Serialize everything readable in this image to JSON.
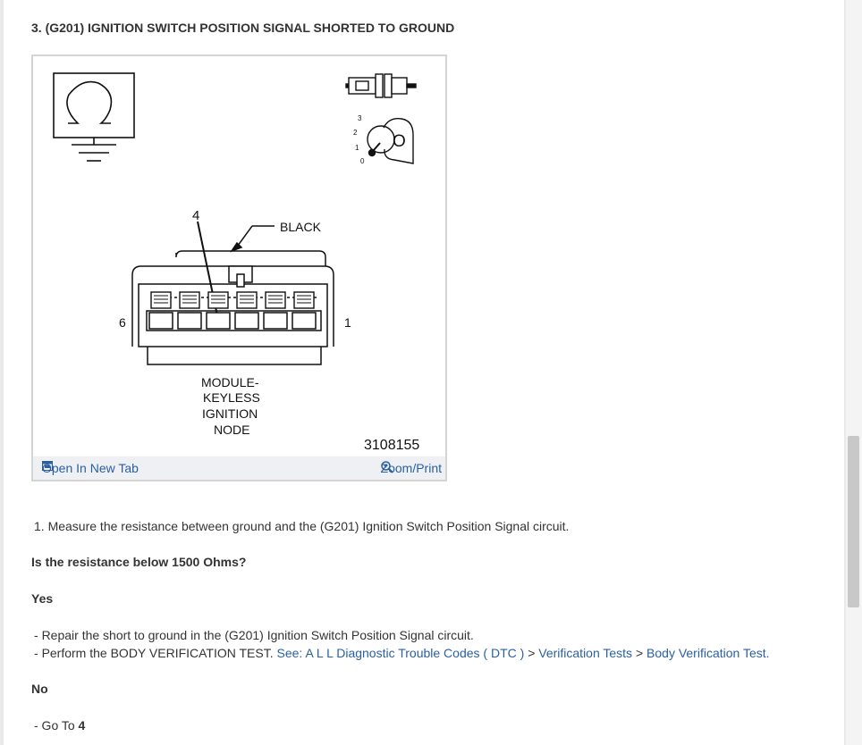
{
  "heading": "3. (G201) IGNITION SWITCH POSITION SIGNAL SHORTED TO GROUND",
  "figure": {
    "diagram_labels": {
      "pin_pointer": "4",
      "black": "BLACK",
      "pin_left": "6",
      "pin_right": "1",
      "module_line1": "MODULE-",
      "module_line2": "KEYLESS",
      "module_line3": "IGNITION",
      "module_line4": "NODE",
      "figure_id": "3108155",
      "key_positions": [
        "3",
        "2",
        "1",
        "0"
      ],
      "key_letter": "O"
    },
    "open_new_tab": "Open In New Tab",
    "zoom_print": "Zoom/Print"
  },
  "step": "1. Measure the resistance between ground and the (G201) Ignition Switch Position Signal circuit.",
  "question": "Is the resistance below 1500 Ohms?",
  "yes": {
    "label": "Yes",
    "items": [
      {
        "bullet": "-",
        "text": "Repair the short to ground in the (G201) Ignition Switch Position Signal circuit."
      },
      {
        "bullet": "-",
        "text": "Perform the BODY VERIFICATION TEST.",
        "link_prefix": "See:",
        "link_parts": [
          "A L L Diagnostic Trouble Codes ( DTC )",
          ">",
          "Verification Tests",
          ">",
          "Body Verification Test."
        ]
      }
    ]
  },
  "no": {
    "label": "No",
    "item_prefix": "- Go To",
    "item_target": "4"
  }
}
